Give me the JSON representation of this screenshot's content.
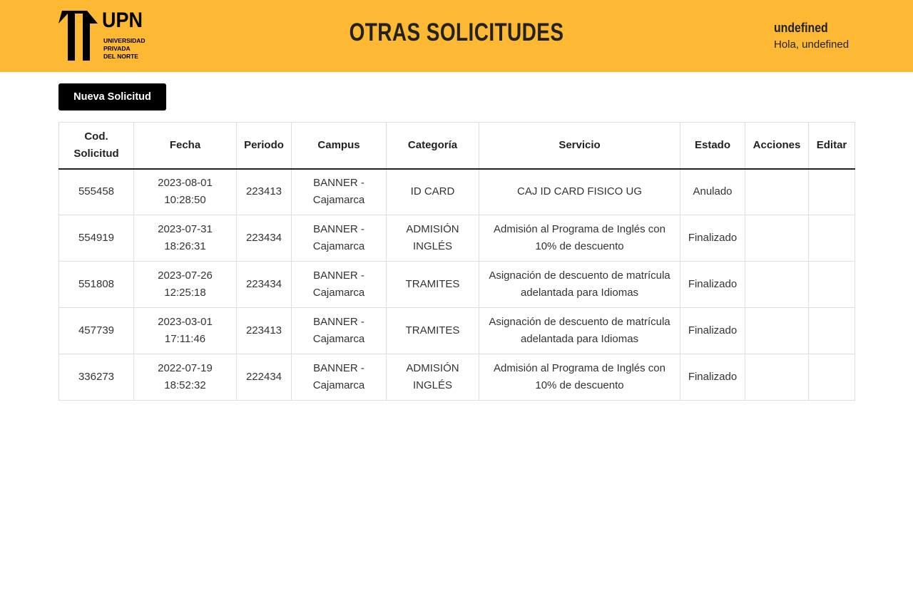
{
  "header": {
    "logo": {
      "brand": "UPN",
      "line1": "UNIVERSIDAD",
      "line2": "PRIVADA",
      "line3": "DEL NORTE"
    },
    "title": "OTRAS SOLICITUDES",
    "user_name": "undefined",
    "greeting": "Hola, undefined"
  },
  "toolbar": {
    "new_request_label": "Nueva Solicitud"
  },
  "table": {
    "headers": [
      "Cod. Solicitud",
      "Fecha",
      "Periodo",
      "Campus",
      "Categoría",
      "Servicio",
      "Estado",
      "Acciones",
      "Editar"
    ],
    "rows": [
      {
        "code": "555458",
        "date": "2023-08-01 10:28:50",
        "period": "223413",
        "campus": "BANNER - Cajamarca",
        "category": "ID CARD",
        "service": "CAJ ID CARD FISICO UG",
        "status": "Anulado",
        "actions": "",
        "edit": ""
      },
      {
        "code": "554919",
        "date": "2023-07-31 18:26:31",
        "period": "223434",
        "campus": "BANNER - Cajamarca",
        "category": "ADMISIÓN INGLÉS",
        "service": "Admisión al Programa de Inglés con 10% de descuento",
        "status": "Finalizado",
        "actions": "",
        "edit": ""
      },
      {
        "code": "551808",
        "date": "2023-07-26 12:25:18",
        "period": "223434",
        "campus": "BANNER - Cajamarca",
        "category": "TRAMITES",
        "service": "Asignación de descuento de matrícula adelantada para Idiomas",
        "status": "Finalizado",
        "actions": "",
        "edit": ""
      },
      {
        "code": "457739",
        "date": "2023-03-01 17:11:46",
        "period": "223413",
        "campus": "BANNER - Cajamarca",
        "category": "TRAMITES",
        "service": "Asignación de descuento de matrícula adelantada para Idiomas",
        "status": "Finalizado",
        "actions": "",
        "edit": ""
      },
      {
        "code": "336273",
        "date": "2022-07-19 18:52:32",
        "period": "222434",
        "campus": "BANNER - Cajamarca",
        "category": "ADMISIÓN INGLÉS",
        "service": "Admisión al Programa de Inglés con 10% de descuento",
        "status": "Finalizado",
        "actions": "",
        "edit": ""
      }
    ]
  },
  "colors": {
    "header_bg": "#FDB933",
    "button_bg": "#000000",
    "text": "#222222"
  }
}
